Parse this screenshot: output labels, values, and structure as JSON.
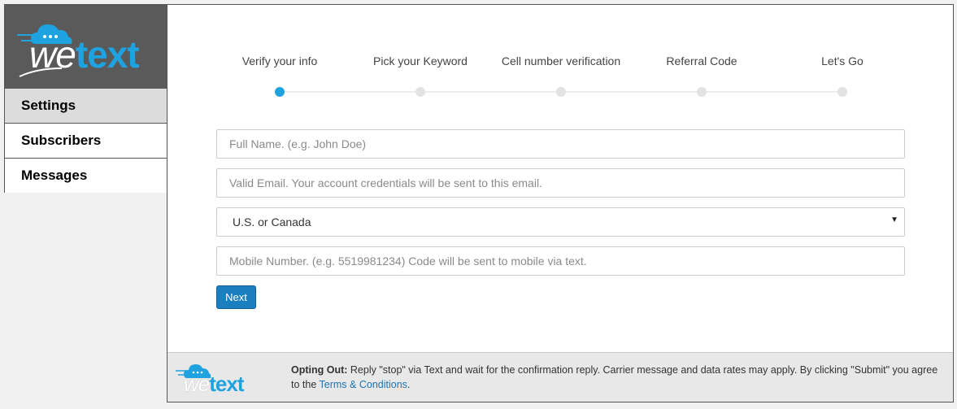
{
  "brand": {
    "logo_text_we": "we",
    "logo_text_text": "text",
    "colors": {
      "accent": "#1ea3e0",
      "sidebar_logo_bg": "#5a5a5a",
      "button": "#1a7fbf",
      "link": "#1a75b8"
    }
  },
  "sidebar": {
    "items": [
      {
        "label": "Settings",
        "active": true
      },
      {
        "label": "Subscribers",
        "active": false
      },
      {
        "label": "Messages",
        "active": false
      }
    ]
  },
  "steps": [
    {
      "label": "Verify your info",
      "active": true
    },
    {
      "label": "Pick your Keyword",
      "active": false
    },
    {
      "label": "Cell number verification",
      "active": false
    },
    {
      "label": "Referral Code",
      "active": false
    },
    {
      "label": "Let's Go",
      "active": false
    }
  ],
  "form": {
    "full_name_placeholder": "Full Name. (e.g. John Doe)",
    "email_placeholder": "Valid Email. Your account credentials will be sent to this email.",
    "country_selected": "U.S. or Canada",
    "mobile_placeholder": "Mobile Number. (e.g. 5519981234) Code will be sent to mobile via text.",
    "next_label": "Next"
  },
  "footer": {
    "opting_out_label": "Opting Out:",
    "text_before_link": " Reply \"stop\" via Text and wait for the confirmation reply. Carrier message and data rates may apply. By clicking \"Submit\" you agree to the ",
    "terms_link": "Terms & Conditions",
    "text_after_link": "."
  },
  "icons": {
    "select_caret": "caret-down-icon",
    "logo_cloud": "cloud-chat-icon"
  }
}
